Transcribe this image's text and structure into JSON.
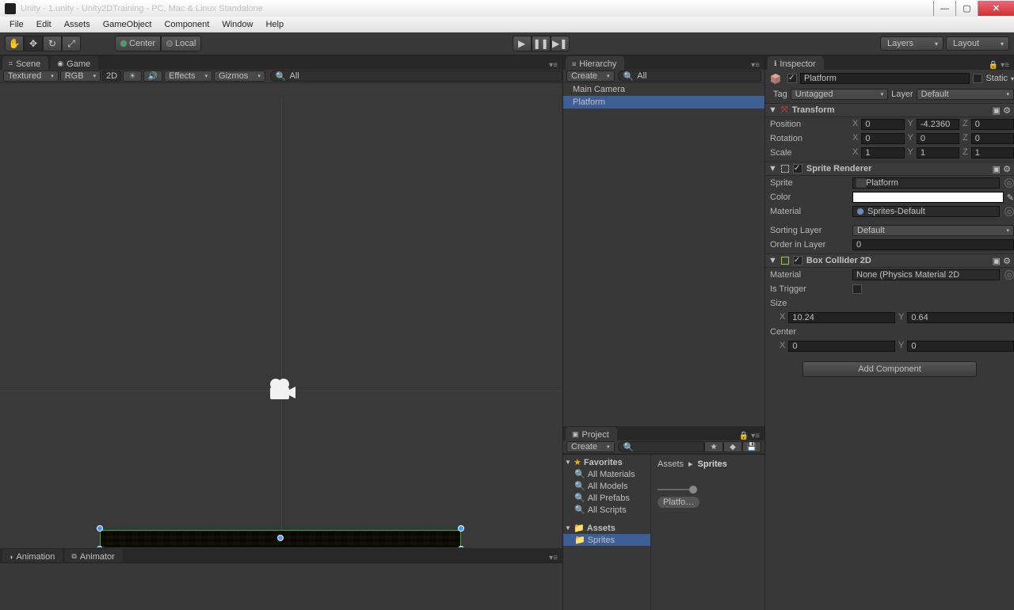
{
  "window_title": "Unity - 1.unity - Unity2DTraining - PC, Mac & Linux Standalone",
  "menubar": [
    "File",
    "Edit",
    "Assets",
    "GameObject",
    "Component",
    "Window",
    "Help"
  ],
  "toolbar": {
    "pivot": "Center",
    "local": "Local",
    "layers": "Layers",
    "layout": "Layout"
  },
  "panels": {
    "scene": "Scene",
    "game": "Game",
    "hierarchy": "Hierarchy",
    "project": "Project",
    "inspector": "Inspector",
    "animation": "Animation",
    "animator": "Animator"
  },
  "scene_toolbar": {
    "shaded": "Textured",
    "rgb": "RGB",
    "mode2d": "2D",
    "effects": "Effects",
    "gizmos": "Gizmos",
    "search": "All"
  },
  "hierarchy": {
    "create": "Create",
    "search_placeholder": "All",
    "items": [
      "Main Camera",
      "Platform"
    ],
    "selected": 1
  },
  "project": {
    "create": "Create",
    "favorites_label": "Favorites",
    "favorites": [
      "All Materials",
      "All Models",
      "All Prefabs",
      "All Scripts"
    ],
    "assets_label": "Assets",
    "folders": [
      "Sprites"
    ],
    "breadcrumb_root": "Assets",
    "breadcrumb_current": "Sprites",
    "asset_chip": "Platfo…"
  },
  "inspector": {
    "object_name": "Platform",
    "static_label": "Static",
    "tag_label": "Tag",
    "tag_value": "Untagged",
    "layer_label": "Layer",
    "layer_value": "Default",
    "transform": {
      "title": "Transform",
      "position_label": "Position",
      "position": {
        "x": "0",
        "y": "-4.2360",
        "z": "0"
      },
      "rotation_label": "Rotation",
      "rotation": {
        "x": "0",
        "y": "0",
        "z": "0"
      },
      "scale_label": "Scale",
      "scale": {
        "x": "1",
        "y": "1",
        "z": "1"
      }
    },
    "sprite_renderer": {
      "title": "Sprite Renderer",
      "sprite_label": "Sprite",
      "sprite_value": "Platform",
      "color_label": "Color",
      "material_label": "Material",
      "material_value": "Sprites-Default",
      "sorting_layer_label": "Sorting Layer",
      "sorting_layer_value": "Default",
      "order_label": "Order in Layer",
      "order_value": "0"
    },
    "box_collider": {
      "title": "Box Collider 2D",
      "material_label": "Material",
      "material_value": "None (Physics Material 2D",
      "trigger_label": "Is Trigger",
      "size_label": "Size",
      "size": {
        "x": "10.24",
        "y": "0.64"
      },
      "center_label": "Center",
      "center": {
        "x": "0",
        "y": "0"
      }
    },
    "add_component": "Add Component"
  }
}
